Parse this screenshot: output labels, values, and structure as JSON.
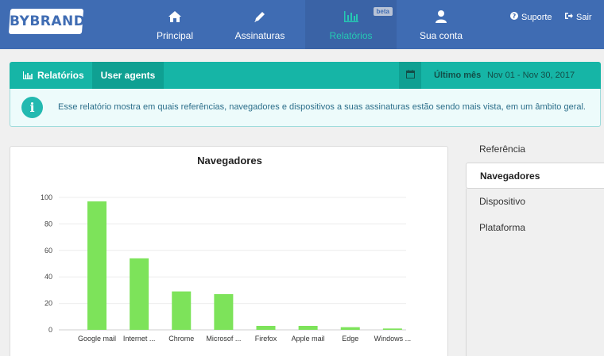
{
  "brand": {
    "logo_text": "BYBRAND",
    "accent": "#3f6cb3",
    "teal": "#16b5a6"
  },
  "nav": {
    "items": [
      {
        "label": "Principal",
        "icon": "home-icon"
      },
      {
        "label": "Assinaturas",
        "icon": "pencil-icon"
      },
      {
        "label": "Relatórios",
        "icon": "bar-chart-icon",
        "badge": "beta",
        "active": true
      },
      {
        "label": "Sua conta",
        "icon": "user-icon"
      }
    ],
    "support_label": "Suporte",
    "logout_label": "Sair"
  },
  "tabs": {
    "reports_label": "Relatórios",
    "user_agents_label": "User agents",
    "period_label": "Último mês",
    "period_range": "Nov 01 - Nov 30, 2017"
  },
  "info": {
    "text": "Esse relatório mostra em quais referências, navegadores e dispositivos a suas assinaturas estão sendo mais vista, em um âmbito geral."
  },
  "side_menu": {
    "items": [
      {
        "label": "Referência"
      },
      {
        "label": "Navegadores",
        "active": true
      },
      {
        "label": "Dispositivo"
      },
      {
        "label": "Plataforma"
      }
    ]
  },
  "chart_data": {
    "type": "bar",
    "title": "Navegadores",
    "categories": [
      "Google mail",
      "Internet ...",
      "Chrome",
      "Microsof ...",
      "Firefox",
      "Apple mail",
      "Edge",
      "Windows ..."
    ],
    "values": [
      97,
      54,
      29,
      27,
      3,
      3,
      2,
      1
    ],
    "ylim": [
      0,
      100
    ],
    "yticks": [
      0,
      20,
      40,
      60,
      80,
      100
    ],
    "bar_color": "#7de35a",
    "grid": true
  }
}
